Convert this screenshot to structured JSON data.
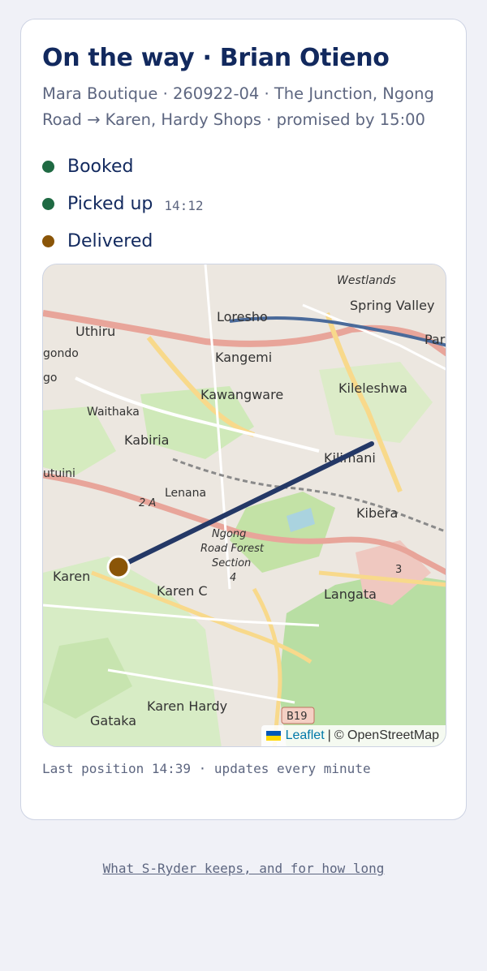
{
  "card": {
    "title": "On the way · Brian Otieno",
    "subtitle": "Mara Boutique · 260922-04 · The Junction, Ngong Road → Karen, Hardy Shops · promised by 15:00"
  },
  "steps": [
    {
      "label": "Booked",
      "time": "",
      "color": "#1f6a43"
    },
    {
      "label": "Picked up",
      "time": "14:12",
      "color": "#1f6a43"
    },
    {
      "label": "Delivered",
      "time": "",
      "color": "#8a5508"
    }
  ],
  "map": {
    "places": {
      "westlands": "Westlands",
      "spring_valley": "Spring Valley",
      "loresho": "Loresho",
      "uthiru": "Uthiru",
      "kangemi": "Kangemi",
      "gondo": "gondo",
      "go": "go",
      "kileleshwa": "Kileleshwa",
      "kawangware": "Kawangware",
      "waithaka": "Waithaka",
      "kabiria": "Kabiria",
      "kilimani": "Kilimani",
      "utuini": "utuini",
      "lenana": "Lenana",
      "kibera": "Kibera",
      "ngong_forest_1": "Ngong",
      "ngong_forest_2": "Road Forest",
      "ngong_forest_3": "Section",
      "ngong_forest_4": "4",
      "karen": "Karen",
      "karen_c": "Karen C",
      "langata": "Langata",
      "karen_hardy": "Karen Hardy",
      "gataka": "Gataka",
      "par": "Par",
      "road_2a": "2 A",
      "road_3": "3",
      "road_b19": "B19"
    },
    "route_color": "#243866",
    "courier_color": "#8a5508",
    "attribution": {
      "leaflet": "Leaflet",
      "separator": "|",
      "osm": "© OpenStreetMap"
    }
  },
  "status": {
    "last_position": "Last position 14:39 · updates every minute"
  },
  "footer": {
    "link": "What S-Ryder keeps, and for how long"
  }
}
